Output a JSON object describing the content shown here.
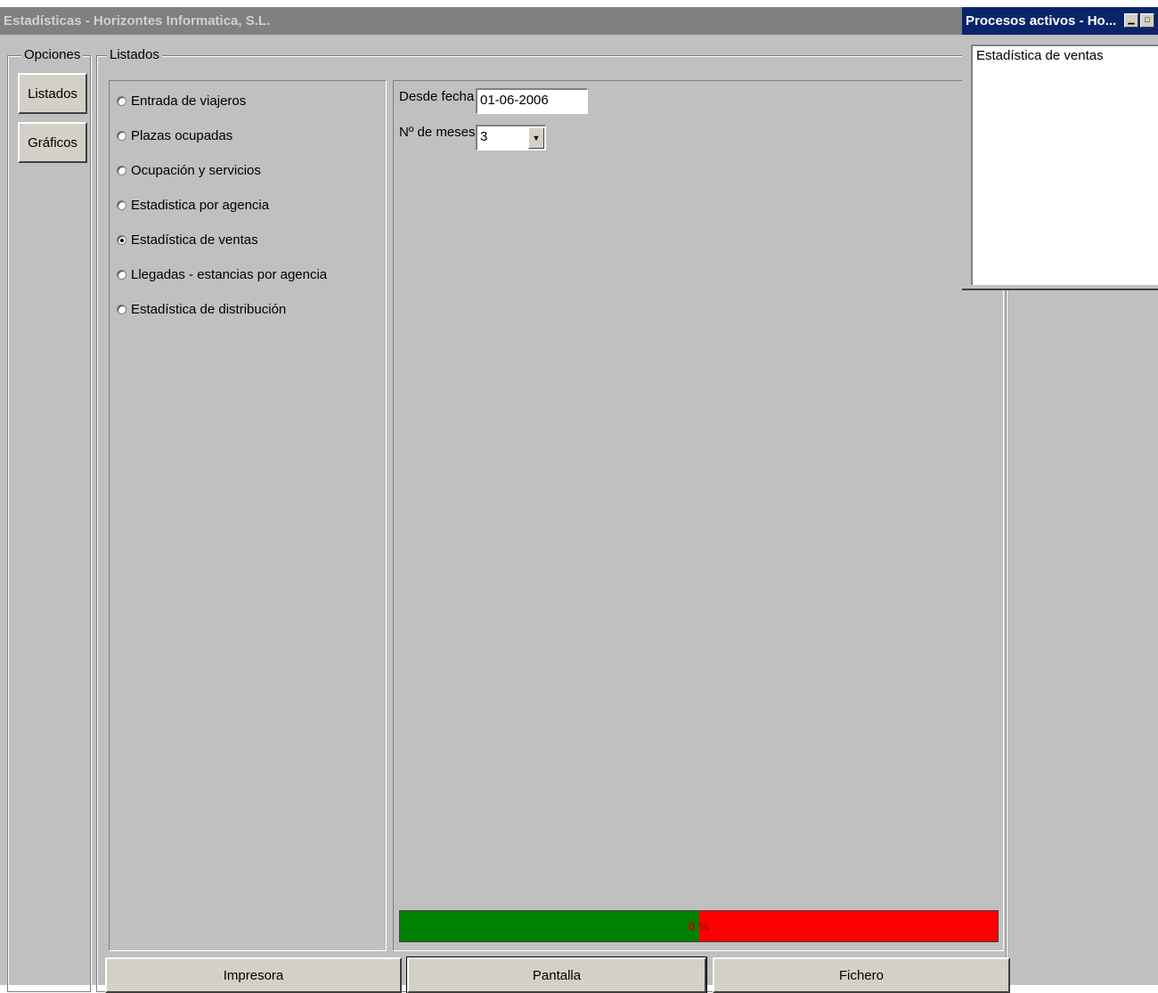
{
  "window": {
    "title": "Estadísticas - Horizontes Informatica, S.L."
  },
  "options": {
    "legend": "Opciones",
    "buttons": [
      "Listados",
      "Gráficos"
    ]
  },
  "listados": {
    "legend": "Listados",
    "reports": [
      {
        "label": "Entrada de viajeros",
        "checked": false
      },
      {
        "label": "Plazas ocupadas",
        "checked": false
      },
      {
        "label": "Ocupación y servicios",
        "checked": false
      },
      {
        "label": "Estadistica por agencia",
        "checked": false
      },
      {
        "label": "Estadística de ventas",
        "checked": true
      },
      {
        "label": "Llegadas - estancias por agencia",
        "checked": false
      },
      {
        "label": "Estadística de distribución",
        "checked": false
      }
    ],
    "params": {
      "desde_fecha_label": "Desde fecha",
      "desde_fecha_value": "01-06-2006",
      "meses_label": "Nº de meses",
      "meses_value": "3"
    },
    "progress": {
      "fraction": 0.5,
      "text": "0 %",
      "fill_color": "#008000",
      "empty_color": "#ff0000"
    }
  },
  "output_buttons": {
    "printer": "Impresora",
    "screen": "Pantalla",
    "file": "Fichero"
  },
  "processes": {
    "title": "Procesos activos - Ho...",
    "items": [
      "Estadística de ventas"
    ]
  }
}
